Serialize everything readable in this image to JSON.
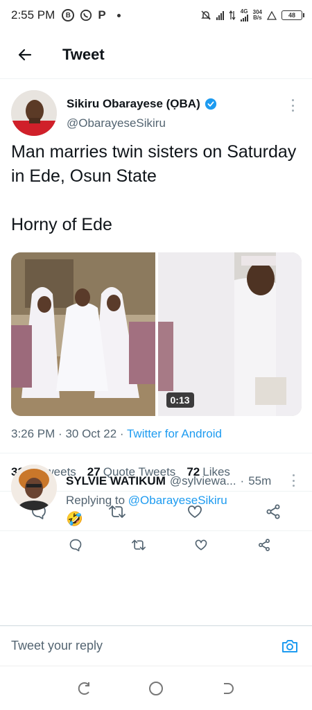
{
  "status_bar": {
    "time": "2:55 PM",
    "app_badges": [
      "B",
      "P"
    ],
    "network_type": "4G",
    "data_speed_value": "304",
    "data_speed_unit": "B/s",
    "battery": "48"
  },
  "header": {
    "title": "Tweet"
  },
  "tweet": {
    "author_name": "Sikiru Obarayese (ỌBA)",
    "author_handle": "@ObarayeseSikiru",
    "text_line1": "Man marries twin sisters on Saturday in Ede, Osun State",
    "text_line2": "Horny of Ede",
    "video_duration": "0:13",
    "time": "3:26 PM",
    "date": "30 Oct 22",
    "source": "Twitter for Android",
    "stats": {
      "retweets_count": "32",
      "retweets_label": "Retweets",
      "quotes_count": "27",
      "quotes_label": "Quote Tweets",
      "likes_count": "72",
      "likes_label": "Likes"
    }
  },
  "reply": {
    "name": "SYLVIE WATIKUM",
    "handle": "@sylviewa...",
    "time": "55m",
    "replying_prefix": "Replying to",
    "replying_to": "@ObarayeseSikiru",
    "text": "🤣"
  },
  "composer": {
    "placeholder": "Tweet your reply"
  },
  "colors": {
    "accent": "#1d9bf0",
    "secondary_text": "#536471",
    "primary_text": "#0f1419"
  }
}
